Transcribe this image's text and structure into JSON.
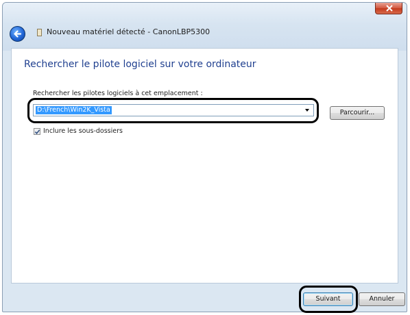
{
  "window": {
    "title": "Nouveau matériel détecté - CanonLBP5300",
    "back_icon": "arrow-left-icon",
    "close_icon": "close-icon",
    "title_icon": "device-icon"
  },
  "main": {
    "heading": "Rechercher le pilote logiciel sur votre ordinateur",
    "path_label": "Rechercher les pilotes logiciels à cet emplacement :",
    "path_value": "D:\\French\\Win2K_Vista",
    "browse_label": "Parcourir...",
    "include_subfolders_label": "Inclure les sous-dossiers",
    "include_subfolders_checked": true
  },
  "footer": {
    "next_label": "Suivant",
    "cancel_label": "Annuler"
  },
  "colors": {
    "heading": "#1f3f8f",
    "selection": "#3399ff",
    "close_button": "#c33a1d"
  }
}
